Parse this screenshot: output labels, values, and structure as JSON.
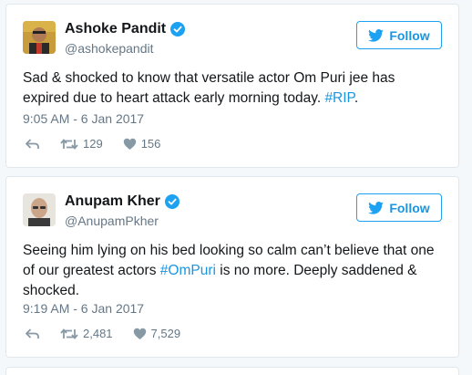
{
  "tweets": [
    {
      "name": "Ashoke Pandit",
      "handle": "@ashokepandit",
      "follow_label": "Follow",
      "text_pre": "Sad & shocked to know that versatile actor Om Puri jee has expired due to heart attack early morning today. ",
      "hashtag": "#RIP",
      "text_post": ".",
      "timestamp": "9:05 AM - 6 Jan 2017",
      "retweets": "129",
      "likes": "156"
    },
    {
      "name": "Anupam Kher",
      "handle": "@AnupamPkher",
      "follow_label": "Follow",
      "text_pre": "Seeing him lying on his bed looking so calm can’t believe that one of our greatest actors ",
      "hashtag": "#OmPuri",
      "text_post": " is no more. Deeply saddened & shocked.",
      "timestamp": "9:19 AM - 6 Jan 2017",
      "retweets": "2,481",
      "likes": "7,529"
    }
  ],
  "icons": {
    "verified": "verified-badge-icon",
    "bird": "twitter-bird-icon",
    "reply": "reply-icon",
    "retweet": "retweet-icon",
    "like": "heart-icon"
  },
  "colors": {
    "accent": "#1da1f2",
    "link": "#1b95e0",
    "muted": "#657786"
  }
}
